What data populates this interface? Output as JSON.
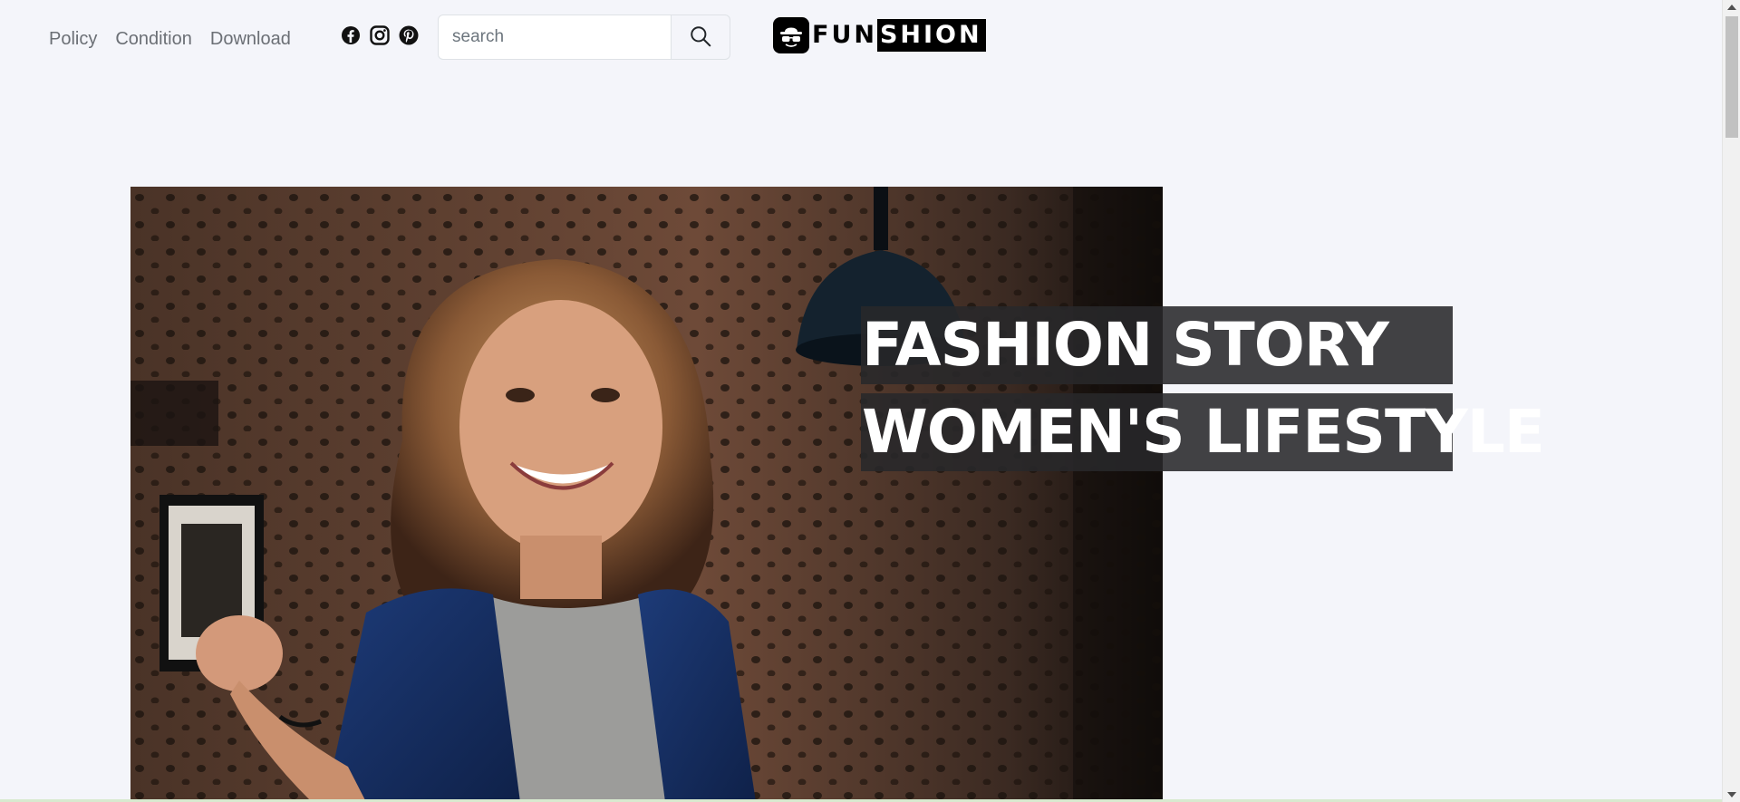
{
  "nav": {
    "links": [
      {
        "label": "Policy"
      },
      {
        "label": "Condition"
      },
      {
        "label": "Download"
      }
    ]
  },
  "social": {
    "icons": [
      "facebook-icon",
      "instagram-icon",
      "pinterest-icon"
    ]
  },
  "search": {
    "placeholder": "search",
    "value": "",
    "button_icon": "search-icon"
  },
  "logo": {
    "part1": "FUN",
    "part2": "SHION",
    "icon": "hat-sunglasses-icon"
  },
  "hero": {
    "line1": "FASHION STORY",
    "line2": "WOMEN'S LIFESTYLE",
    "image": "smiling-woman-brick-wall-photo"
  },
  "colors": {
    "background": "#f4f5fa",
    "nav_text": "#6b6f75",
    "headline_bg": "#28282a",
    "headline_text": "#ffffff",
    "logo": "#000000"
  }
}
